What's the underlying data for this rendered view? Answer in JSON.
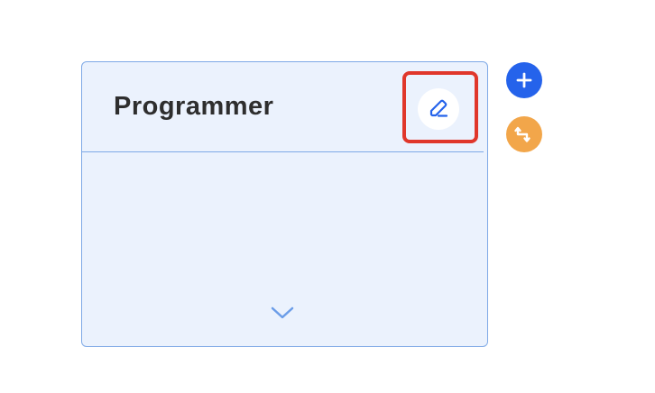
{
  "card": {
    "title": "Programmer"
  },
  "icons": {
    "edit": "pencil-icon",
    "expand": "chevron-down-icon",
    "add": "plus-icon",
    "route": "route-icon"
  },
  "colors": {
    "card_background": "#ebf2fd",
    "card_border": "#7ea9e6",
    "highlight": "#e0372b",
    "add_button": "#2563eb",
    "route_button": "#f2a64a"
  }
}
